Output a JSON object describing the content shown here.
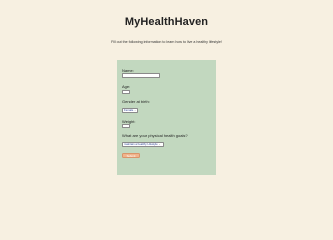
{
  "header": {
    "title": "MyHealthHaven",
    "subtitle": "Fill out the following information to learn how to live a healthy lifestyle!"
  },
  "form": {
    "name": {
      "label": "Name:",
      "value": ""
    },
    "age": {
      "label": "Age:",
      "value": ""
    },
    "gender": {
      "label": "Gender at birth:",
      "selected": "Female"
    },
    "weight": {
      "label": "Weight:",
      "value": ""
    },
    "goals": {
      "label": "What are your physical health goals?",
      "selected": "maintain a healthy Lifestyle"
    },
    "submit_label": "Submit"
  },
  "colors": {
    "background": "#f7f0e1",
    "panel": "#c2d8bf",
    "submit_button": "#f1b48c"
  }
}
